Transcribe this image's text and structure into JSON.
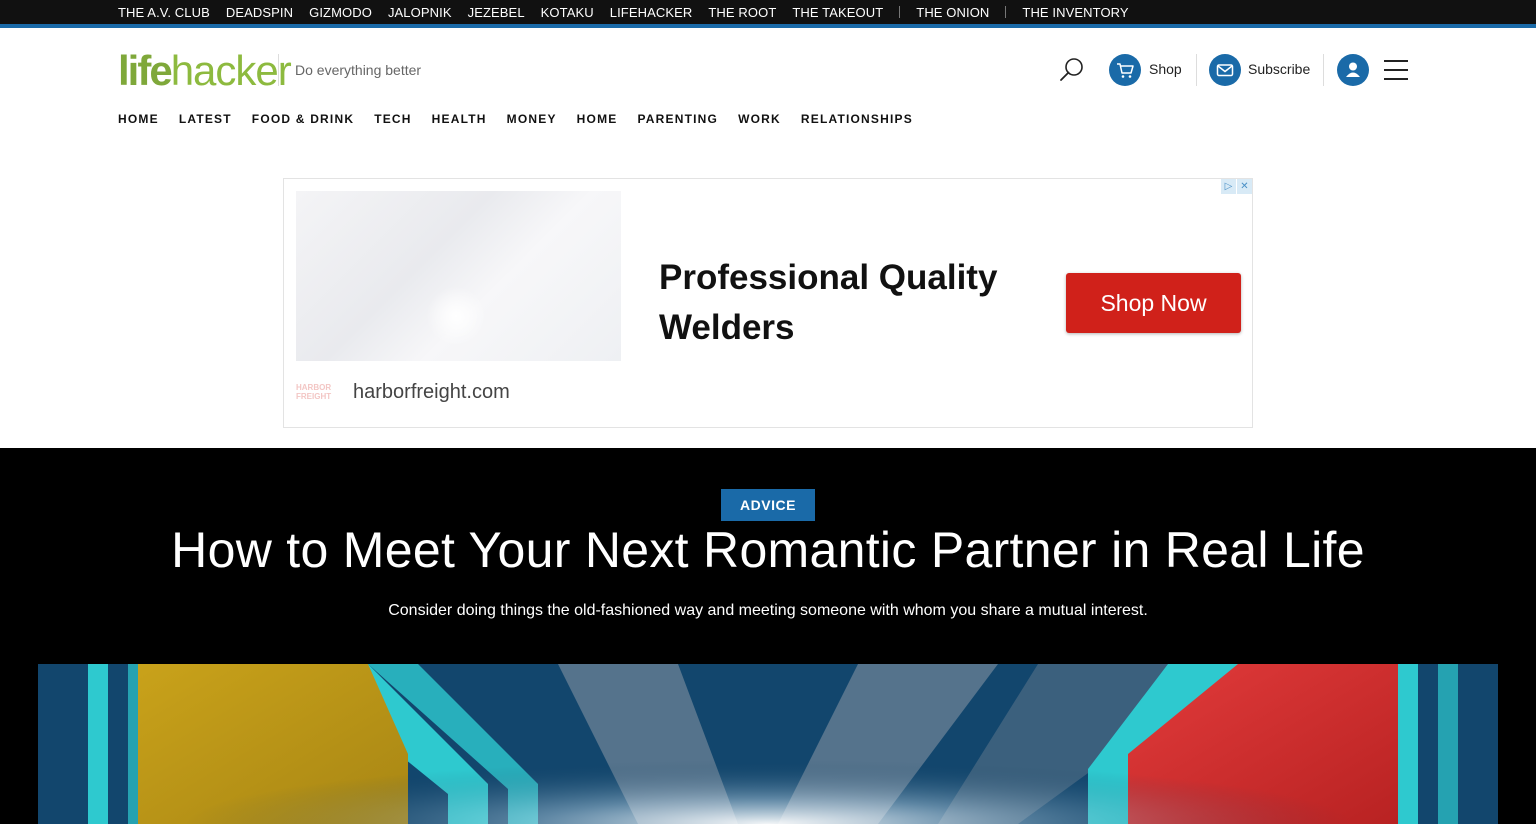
{
  "network": {
    "links": [
      "THE A.V. CLUB",
      "DEADSPIN",
      "GIZMODO",
      "JALOPNIK",
      "JEZEBEL",
      "KOTAKU",
      "LIFEHACKER",
      "THE ROOT",
      "THE TAKEOUT"
    ],
    "extra": [
      "THE ONION",
      "THE INVENTORY"
    ]
  },
  "header": {
    "logo_part1": "life",
    "logo_part2": "hacker",
    "tagline": "Do everything better",
    "shop_label": "Shop",
    "subscribe_label": "Subscribe"
  },
  "nav": {
    "items": [
      "HOME",
      "LATEST",
      "FOOD & DRINK",
      "TECH",
      "HEALTH",
      "MONEY",
      "HOME",
      "PARENTING",
      "WORK",
      "RELATIONSHIPS"
    ]
  },
  "ad": {
    "headline": "Professional Quality Welders",
    "cta": "Shop Now",
    "domain": "harborfreight.com",
    "logo_text": "HARBOR FREIGHT"
  },
  "article": {
    "category": "ADVICE",
    "title": "How to Meet Your Next Romantic Partner in Real Life",
    "dek": "Consider doing things the old-fashioned way and meeting someone with whom you share a mutual interest."
  },
  "colors": {
    "brand_green": "#8dba3f",
    "accent_blue": "#1a6aa8",
    "cta_red": "#d0211a"
  }
}
